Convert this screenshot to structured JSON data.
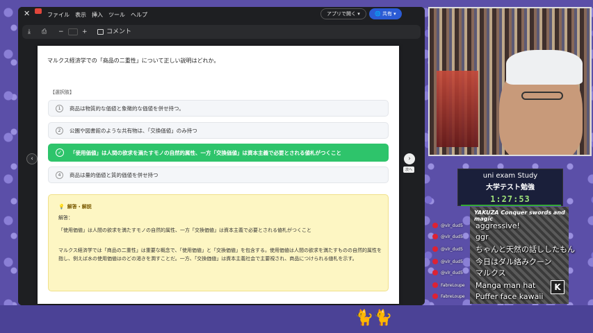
{
  "viewer": {
    "menus": [
      "ファイル",
      "表示",
      "挿入",
      "ツール",
      "ヘルプ"
    ],
    "open_app": "アプリで開く ▾",
    "share": "🌐 共有 ▾",
    "toolbar": {
      "download": "⤓",
      "print": "⎙",
      "minus": "−",
      "plus": "+",
      "comment": "コメント"
    }
  },
  "quiz": {
    "question": "マルクス経済学での「商品の二重性」について正しい説明はどれか。",
    "choices_label": "【選択肢】",
    "choices": [
      {
        "num": "1",
        "text": "商品は物質的な価値と象徴的な価値を併せ持つ。"
      },
      {
        "num": "2",
        "text": "公園や図書館のような共有物は、「交換価値」のみ持つ"
      },
      {
        "num": "✓",
        "text": "「使用価値」は人間の欲求を満たすモノの自然的属性、一方「交換価値」は資本主義で必要とされる値札がつくこと"
      },
      {
        "num": "4",
        "text": "商品は量的価値と質的価値を併せ持つ"
      }
    ],
    "explanation": {
      "title": "解答・解説",
      "answer_label": "解答：",
      "answer": "「使用価値」は人間の欲求を満たすモノの自然的属性、一方「交換価値」は資本主義で必要とされる値札がつくこと",
      "detail": "マルクス経済学では「商品の二重性」は重要な概念で、「使用価値」と「交換価値」を包含する。使用価値は人間の欲求を満たすものの自然的属性を指し、例えば水の使用価値はのどの渇きを潤すことだ。一方、「交換価値」は資本主義社会で主要視され、商品につけられる値札を示す。"
    },
    "next_tip": "次へ"
  },
  "stream": {
    "title_en": "uni exam Study",
    "title_ja": "大学テスト勉強",
    "timer": "1:27:53",
    "manga_title": "YAKUZA Conquer swords and magic",
    "chat": [
      {
        "user": "@vlr_dud5",
        "msg": "aggressive!"
      },
      {
        "user": "@vlr_dud5",
        "msg": "ggr"
      },
      {
        "user": "@vlr_dud5",
        "msg": "ちゃんと天然の話ししたもん"
      },
      {
        "user": "@vlr_dud5",
        "msg": "今日はダル絡みクーン"
      },
      {
        "user": "@vlr_dud5",
        "msg": "マルクス"
      },
      {
        "user": "FabreLoupe",
        "msg": "Manga man hat"
      },
      {
        "user": "FabreLoupe",
        "msg": "Puffer face kawaii"
      }
    ]
  },
  "colors": {
    "correct": "#2ec46b",
    "explain_bg": "#fdf6c3",
    "share": "#2b5bd4"
  }
}
